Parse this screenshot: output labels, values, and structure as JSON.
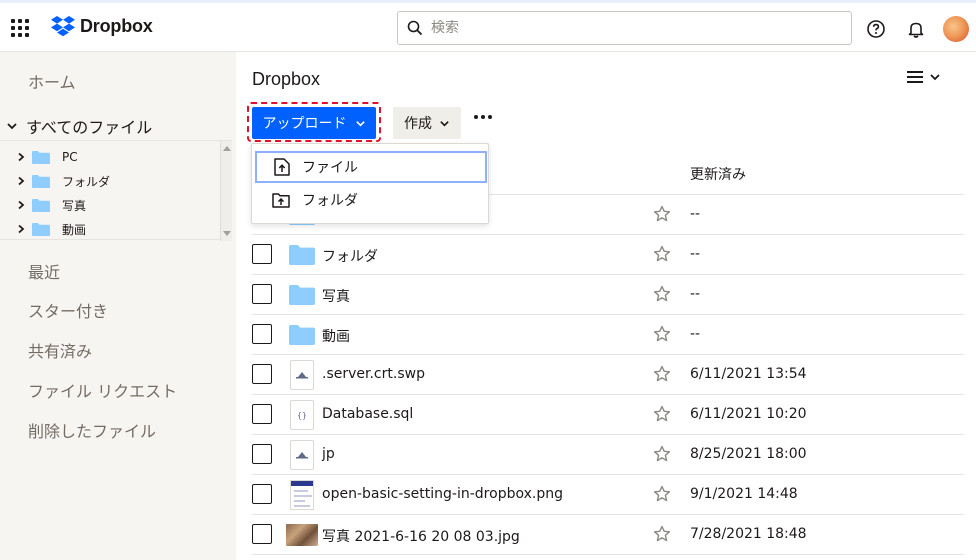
{
  "app": {
    "name": "Dropbox"
  },
  "search": {
    "placeholder": "検索"
  },
  "sidebar": {
    "home": "ホーム",
    "all_files": "すべてのファイル",
    "tree": [
      "PC",
      "フォルダ",
      "写真",
      "動画"
    ],
    "links": [
      "最近",
      "スター付き",
      "共有済み",
      "ファイル リクエスト",
      "削除したファイル"
    ]
  },
  "main": {
    "title": "Dropbox",
    "upload_label": "アップロード",
    "create_label": "作成",
    "menu": [
      "ファイル",
      "フォルダ"
    ],
    "column_modified": "更新済み",
    "rows": [
      {
        "name": "",
        "modified": "--",
        "kind": "folder"
      },
      {
        "name": "フォルダ",
        "modified": "--",
        "kind": "folder"
      },
      {
        "name": "写真",
        "modified": "--",
        "kind": "folder"
      },
      {
        "name": "動画",
        "modified": "--",
        "kind": "folder"
      },
      {
        "name": ".server.crt.swp",
        "modified": "6/11/2021 13:54",
        "kind": "generic-file"
      },
      {
        "name": "Database.sql",
        "modified": "6/11/2021 10:20",
        "kind": "code-file"
      },
      {
        "name": "jp",
        "modified": "8/25/2021 18:00",
        "kind": "generic-file"
      },
      {
        "name": "open-basic-setting-in-dropbox.png",
        "modified": "9/1/2021 14:48",
        "kind": "image-thumbnail"
      },
      {
        "name": "写真 2021-6-16 20 08 03.jpg",
        "modified": "7/28/2021 18:48",
        "kind": "photo-thumbnail"
      }
    ]
  },
  "colors": {
    "accent": "#0061fe",
    "folder": "#8fcdff",
    "highlight": "#e0112b"
  }
}
